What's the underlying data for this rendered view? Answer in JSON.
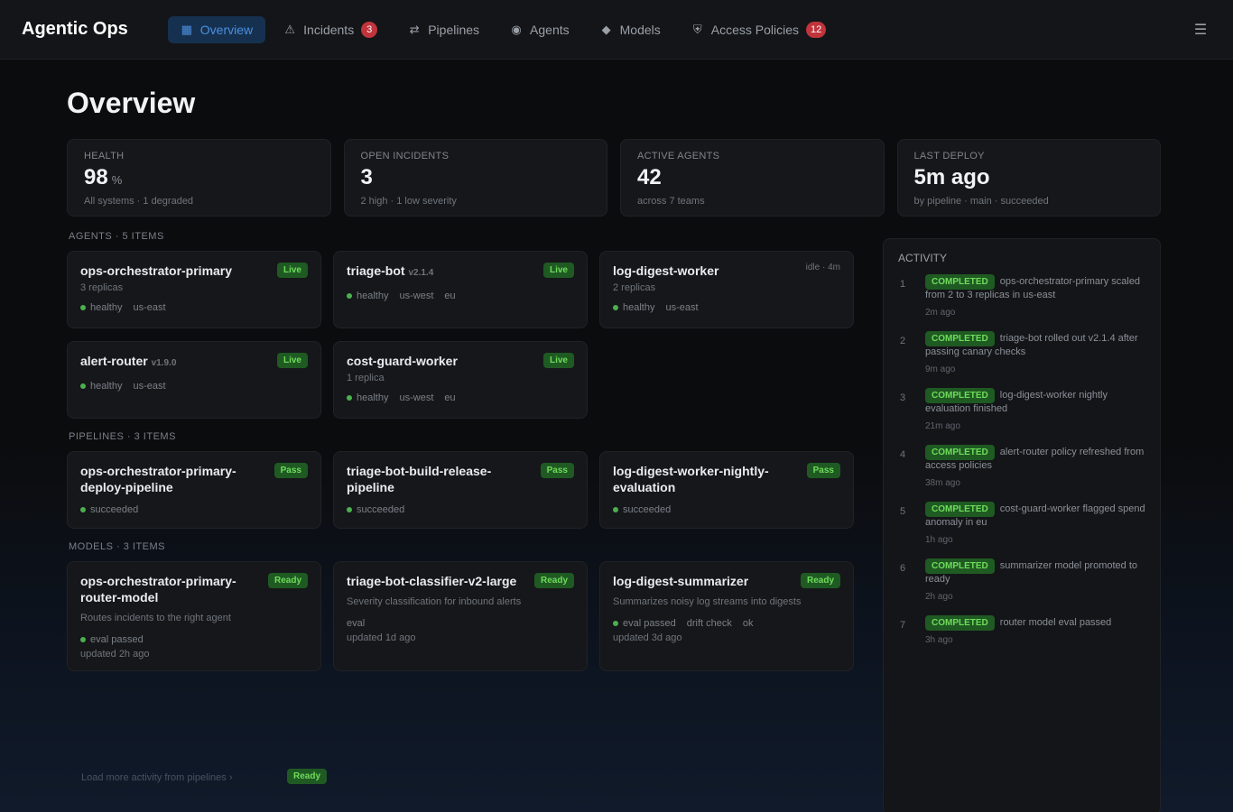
{
  "app": {
    "title": "Agentic Ops"
  },
  "nav": {
    "items": [
      {
        "label": "Overview",
        "icon": "grid-icon",
        "active": true
      },
      {
        "label": "Incidents",
        "icon": "alert-icon",
        "badge": "3"
      },
      {
        "label": "Pipelines",
        "icon": "flow-icon"
      },
      {
        "label": "Agents",
        "icon": "bot-icon"
      },
      {
        "label": "Models",
        "icon": "cube-icon"
      },
      {
        "label": "Access Policies",
        "icon": "shield-icon",
        "badge": "12"
      }
    ],
    "right_icon": "menu-icon"
  },
  "page": {
    "title": "Overview"
  },
  "stats": [
    {
      "label": "HEALTH",
      "value": "98",
      "unit": "%",
      "sub": "All systems · 1 degraded"
    },
    {
      "label": "OPEN INCIDENTS",
      "value": "3",
      "unit": "",
      "sub": "2 high · 1 low severity"
    },
    {
      "label": "ACTIVE AGENTS",
      "value": "42",
      "unit": "",
      "sub": "across 7 teams"
    },
    {
      "label": "LAST DEPLOY",
      "value": "5m ago",
      "unit": "",
      "sub": "by pipeline · main · succeeded"
    }
  ],
  "sections": [
    {
      "label": "AGENTS · 5 ITEMS",
      "cards": [
        {
          "title": "ops-orchestrator-primary",
          "meta": "3 replicas",
          "status": "Live",
          "tags": [
            "healthy",
            "us-east"
          ]
        },
        {
          "title": "triage-bot",
          "meta": "v2.1.4",
          "status": "Live",
          "tags": [
            "healthy",
            "us-west",
            "eu"
          ]
        },
        {
          "title": "log-digest-worker",
          "meta": "2 replicas",
          "status_muted": "idle · 4m",
          "tags": [
            "healthy",
            "us-east"
          ]
        },
        {
          "title": "alert-router",
          "meta": "v1.9.0",
          "status": "Live",
          "tags": [
            "healthy",
            "us-east"
          ]
        },
        {
          "title": "cost-guard-worker",
          "meta": "1 replica",
          "status": "Live",
          "tags": [
            "healthy",
            "us-west",
            "eu"
          ]
        }
      ]
    },
    {
      "label": "PIPELINES · 3 ITEMS",
      "cards": [
        {
          "title": "ops-orchestrator-primary-deploy-pipeline",
          "meta": "",
          "status": "Pass",
          "tags": [
            "succeeded"
          ]
        },
        {
          "title": "triage-bot-build-release-pipeline",
          "meta": "",
          "status": "Pass",
          "tags": [
            "succeeded"
          ]
        },
        {
          "title": "log-digest-worker-nightly-evaluation",
          "meta": "",
          "status": "Pass",
          "tags": [
            "succeeded"
          ]
        }
      ]
    },
    {
      "label": "MODELS · 3 ITEMS",
      "cards": [
        {
          "title": "ops-orchestrator-primary-router-model",
          "desc": "Routes incidents to the right agent",
          "tags": [
            "eval passed"
          ],
          "foot": "updated 2h ago",
          "status": "Ready"
        },
        {
          "title": "triage-bot-classifier-v2-large",
          "desc": "Severity classification for inbound alerts",
          "tags": [
            "eval"
          ],
          "foot": "updated 1d ago",
          "status": "Ready"
        },
        {
          "title": "log-digest-summarizer",
          "desc": "Summarizes noisy log streams into digests",
          "tags": [
            "eval passed",
            "drift check",
            "ok"
          ],
          "foot": "updated 3d ago",
          "status": "Ready"
        }
      ]
    }
  ],
  "activity": {
    "title": "ACTIVITY",
    "items": [
      {
        "n": "1",
        "tag": "COMPLETED",
        "text": "ops-orchestrator-primary scaled from 2 to 3 replicas in us-east",
        "time": "2m ago"
      },
      {
        "n": "2",
        "tag": "COMPLETED",
        "text": "triage-bot rolled out v2.1.4 after passing canary checks",
        "time": "9m ago"
      },
      {
        "n": "3",
        "tag": "COMPLETED",
        "text": "log-digest-worker nightly evaluation finished",
        "time": "21m ago"
      },
      {
        "n": "4",
        "tag": "COMPLETED",
        "text": "alert-router policy refreshed from access policies",
        "time": "38m ago"
      },
      {
        "n": "5",
        "tag": "COMPLETED",
        "text": "cost-guard-worker flagged spend anomaly in eu",
        "time": "1h ago"
      },
      {
        "n": "6",
        "tag": "COMPLETED",
        "text": "summarizer model promoted to ready",
        "time": "2h ago"
      },
      {
        "n": "7",
        "tag": "COMPLETED",
        "text": "router model eval passed",
        "time": "3h ago"
      }
    ]
  },
  "footer": {
    "hint": "Load more activity from pipelines ›",
    "pill": "Ready"
  },
  "colors": {
    "accent": "#4a90e2",
    "success": "#6fdc5a",
    "danger": "#c0343c"
  }
}
